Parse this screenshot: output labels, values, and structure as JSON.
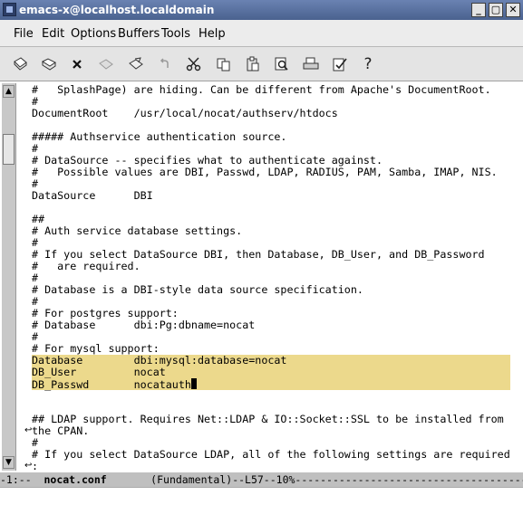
{
  "window": {
    "title": "emacs-x@localhost.localdomain",
    "buttons": [
      "_",
      "▢",
      "✕"
    ]
  },
  "menu": [
    "File",
    "Edit",
    "Options",
    "Buffers",
    "Tools",
    "Help"
  ],
  "toolbar_icons": [
    "new-file-icon",
    "open-folder-icon",
    "close-buffer-icon",
    "save-icon",
    "save-as-icon",
    "undo-icon",
    "cut-icon",
    "copy-icon",
    "paste-icon",
    "search-icon",
    "print-icon",
    "preferences-icon",
    "help-icon"
  ],
  "buffer": {
    "lines": [
      "#   SplashPage) are hiding. Can be different from Apache's DocumentRoot.",
      "#",
      "DocumentRoot    /usr/local/nocat/authserv/htdocs",
      "",
      "##### Authservice authentication source.",
      "#",
      "# DataSource -- specifies what to authenticate against.",
      "#   Possible values are DBI, Passwd, LDAP, RADIUS, PAM, Samba, IMAP, NIS.",
      "#",
      "DataSource      DBI",
      "",
      "##",
      "# Auth service database settings.",
      "#",
      "# If you select DataSource DBI, then Database, DB_User, and DB_Password",
      "#   are required.",
      "#",
      "# Database is a DBI-style data source specification.",
      "#",
      "# For postgres support:",
      "# Database      dbi:Pg:dbname=nocat",
      "#",
      "# For mysql support:",
      "Database        dbi:mysql:database=nocat",
      "DB_User         nocat",
      "DB_Passwd       nocatauth",
      "",
      "",
      "## LDAP support. Requires Net::LDAP & IO::Socket::SSL to be installed from",
      "the CPAN.",
      "#",
      "# If you select DataSource LDAP, all of the following settings are required",
      ":"
    ],
    "highlighted_lines": [
      23,
      24,
      25
    ],
    "cursor_line": 25,
    "wrapped_lines": [
      29,
      32
    ]
  },
  "modeline": {
    "prefix": "-1:--  ",
    "buffer_name": "nocat.conf",
    "rest": "       (Fundamental)--L57--10%-----------------------------------------"
  },
  "colors": {
    "highlight": "#ecd98c",
    "titlebar": "#4a628f"
  }
}
